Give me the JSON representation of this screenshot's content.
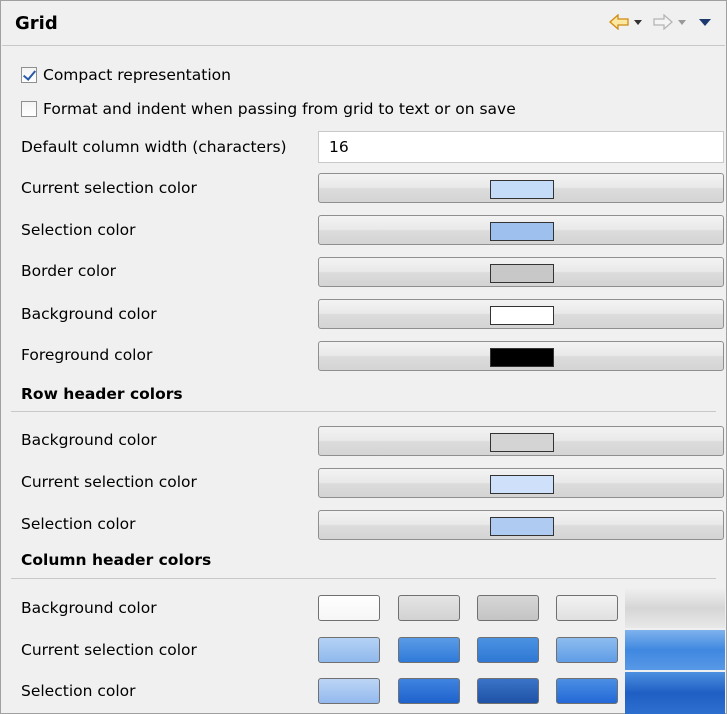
{
  "header": {
    "title": "Grid"
  },
  "options": {
    "compact": {
      "label": "Compact representation",
      "checked": true
    },
    "format": {
      "label": "Format and indent when passing from grid to text or on save",
      "checked": false
    },
    "column_width": {
      "label": "Default column width (characters)",
      "value": "16"
    }
  },
  "colors": [
    {
      "label": "Current selection color",
      "swatch": "#c5dcf8"
    },
    {
      "label": "Selection color",
      "swatch": "#9ec0ef"
    },
    {
      "label": "Border color",
      "swatch": "#c8c8c8"
    },
    {
      "label": "Background color",
      "swatch": "#ffffff"
    },
    {
      "label": "Foreground color",
      "swatch": "#000000"
    }
  ],
  "row_header": {
    "title": "Row header colors",
    "items": [
      {
        "label": "Background color",
        "swatch": "#d4d4d4"
      },
      {
        "label": "Current selection color",
        "swatch": "#cfe1fa"
      },
      {
        "label": "Selection color",
        "swatch": "#b0cbf1"
      }
    ]
  },
  "column_header": {
    "title": "Column header colors",
    "items": [
      {
        "label": "Background color",
        "swatches": [
          "#ffffff",
          "#d8d8d8",
          "#cccccc",
          "#e8e8e8"
        ],
        "bar": "#d9d9d9"
      },
      {
        "label": "Current selection color",
        "swatches": [
          "#9fc3f0",
          "#3b87e0",
          "#3a84dc",
          "#78adec"
        ],
        "bar": "#4a8fe2"
      },
      {
        "label": "Selection color",
        "swatches": [
          "#a5c5f1",
          "#2a71d8",
          "#2a62b8",
          "#2f79de"
        ],
        "bar": "#2d6fcf"
      }
    ]
  }
}
